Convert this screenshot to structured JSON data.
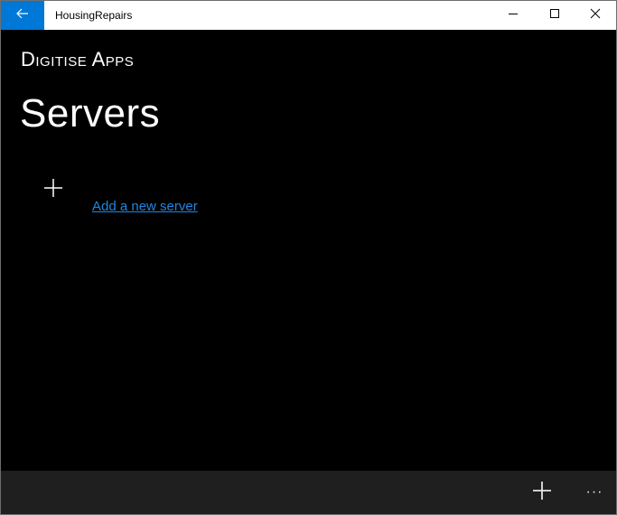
{
  "window": {
    "title": "HousingRepairs",
    "back_icon": "arrow-left-icon",
    "controls": [
      "minimize-icon",
      "maximize-icon",
      "close-icon"
    ]
  },
  "header": {
    "brand": "Digitise Apps",
    "page_title": "Servers"
  },
  "main": {
    "add_icon": "plus-icon",
    "add_link_label": "Add a new server"
  },
  "appbar": {
    "add_icon": "plus-icon",
    "more_label": "···"
  },
  "colors": {
    "accent": "#0078d7",
    "link": "#1f86e0",
    "background": "#000000",
    "appbar": "#1f1f1f"
  }
}
